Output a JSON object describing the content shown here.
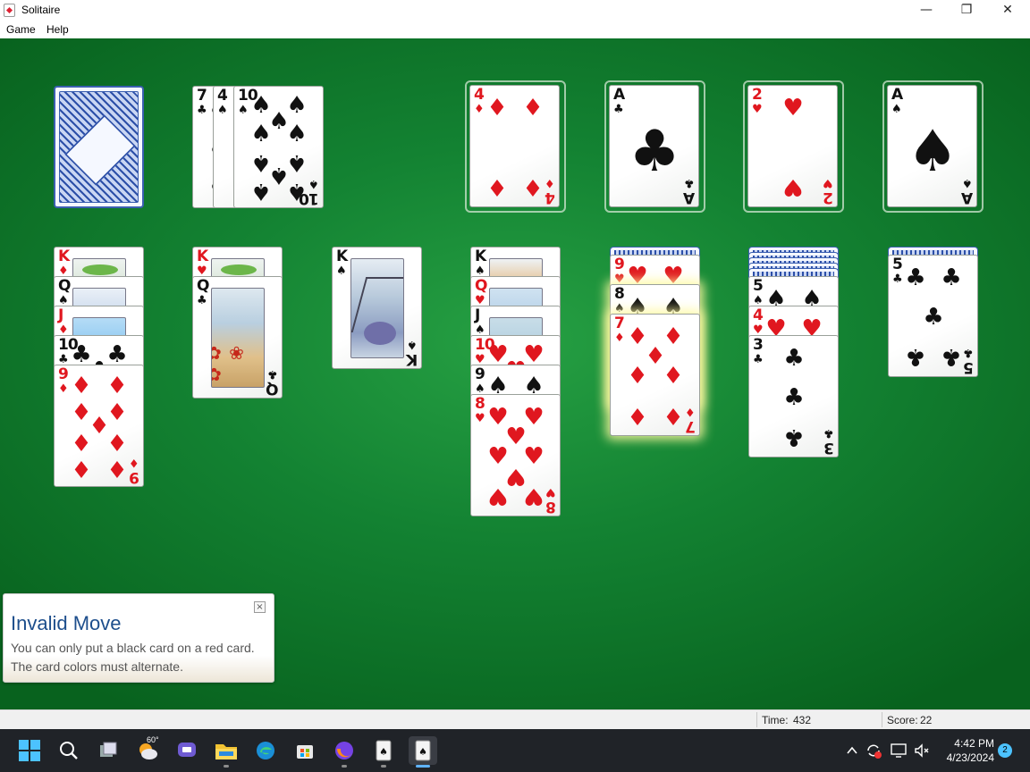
{
  "window": {
    "title": "Solitaire",
    "min_icon": "minimize-icon",
    "max_icon": "restore-icon",
    "close_icon": "close-icon"
  },
  "menu": {
    "items": [
      "Game",
      "Help"
    ]
  },
  "colors": {
    "felt": "#138232",
    "red_suit": "#e0171f",
    "black_suit": "#111111",
    "toast_title": "#1d4e8c",
    "taskbar": "#202328"
  },
  "stock": {
    "state": "face-down card back"
  },
  "waste": [
    {
      "rank": "7",
      "suit": "♣",
      "color": "black"
    },
    {
      "rank": "4",
      "suit": "♠",
      "color": "black"
    },
    {
      "rank": "10",
      "suit": "♠",
      "color": "black"
    }
  ],
  "foundations": [
    {
      "rank": "4",
      "suit": "♦",
      "color": "red"
    },
    {
      "rank": "A",
      "suit": "♣",
      "color": "black"
    },
    {
      "rank": "2",
      "suit": "♥",
      "color": "red"
    },
    {
      "rank": "A",
      "suit": "♠",
      "color": "black"
    }
  ],
  "tableau": [
    {
      "hidden": 0,
      "cards": [
        {
          "rank": "K",
          "suit": "♦"
        },
        {
          "rank": "Q",
          "suit": "♠"
        },
        {
          "rank": "J",
          "suit": "♦"
        },
        {
          "rank": "10",
          "suit": "♣"
        },
        {
          "rank": "9",
          "suit": "♦"
        }
      ]
    },
    {
      "hidden": 0,
      "cards": [
        {
          "rank": "K",
          "suit": "♥"
        },
        {
          "rank": "Q",
          "suit": "♣"
        }
      ]
    },
    {
      "hidden": 0,
      "cards": [
        {
          "rank": "K",
          "suit": "♠"
        }
      ]
    },
    {
      "hidden": 0,
      "cards": [
        {
          "rank": "K",
          "suit": "♠"
        },
        {
          "rank": "Q",
          "suit": "♥"
        },
        {
          "rank": "J",
          "suit": "♠"
        },
        {
          "rank": "10",
          "suit": "♥"
        },
        {
          "rank": "9",
          "suit": "♠"
        },
        {
          "rank": "8",
          "suit": "♥"
        }
      ]
    },
    {
      "hidden": 1,
      "cards": [
        {
          "rank": "9",
          "suit": "♥"
        },
        {
          "rank": "8",
          "suit": "♠"
        },
        {
          "rank": "7",
          "suit": "♦"
        }
      ]
    },
    {
      "hidden": 5,
      "cards": [
        {
          "rank": "5",
          "suit": "♠"
        },
        {
          "rank": "4",
          "suit": "♥"
        },
        {
          "rank": "3",
          "suit": "♣"
        }
      ]
    },
    {
      "hidden": 1,
      "cards": [
        {
          "rank": "5",
          "suit": "♣"
        }
      ]
    }
  ],
  "toast": {
    "title": "Invalid Move",
    "message": "You can only put a black card on a red card. The card colors must alternate.",
    "close_glyph": "×"
  },
  "status": {
    "time_label": "Time:",
    "time_value": "432",
    "score_label": "Score:",
    "score_value": "22"
  },
  "taskbar": {
    "weather_temp": "60°",
    "apps": [
      "start-icon",
      "search-icon",
      "task-view-icon",
      "weather-icon",
      "teams-chat-icon",
      "file-explorer-icon",
      "edge-icon",
      "store-icon",
      "firefox-icon",
      "solitaire-icon",
      "solitaire-active-icon"
    ],
    "clock_time": "4:42 PM",
    "clock_date": "4/23/2024",
    "notification_count": "2"
  }
}
